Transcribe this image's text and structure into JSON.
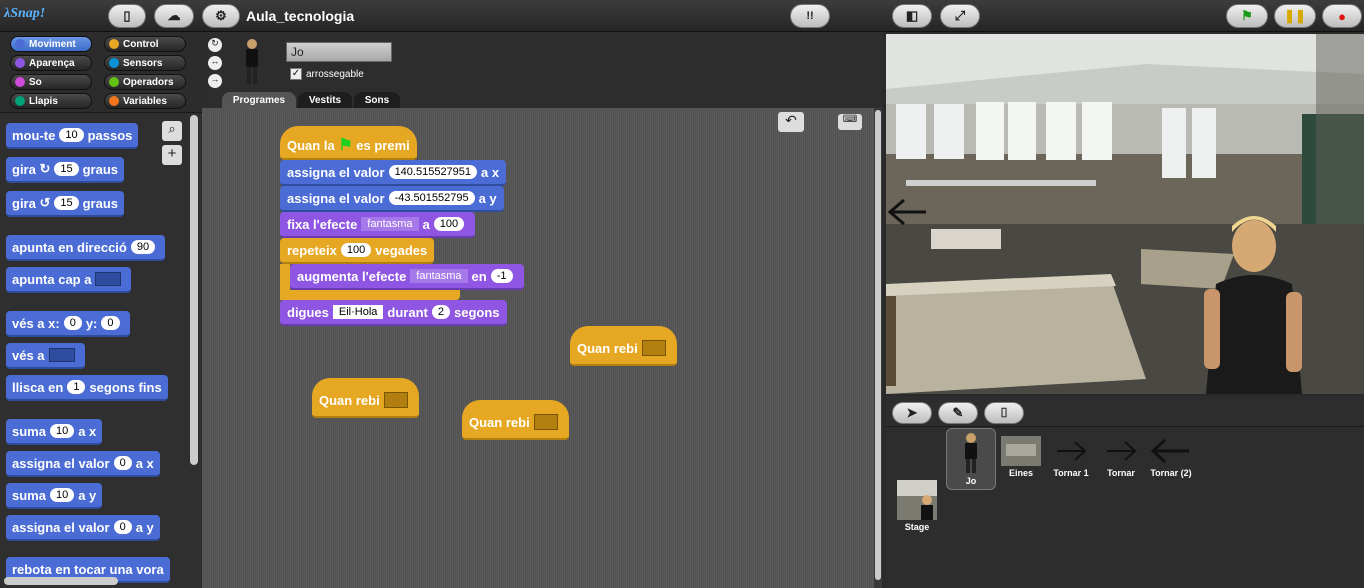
{
  "app": {
    "logo": "λSnap!",
    "project_name": "Aula_tecnologia"
  },
  "categories": [
    {
      "label": "Moviment",
      "color": "#4a6cd4"
    },
    {
      "label": "Control",
      "color": "#e6a822"
    },
    {
      "label": "Aparença",
      "color": "#8f56e3"
    },
    {
      "label": "Sensors",
      "color": "#0a94d6"
    },
    {
      "label": "So",
      "color": "#cf4ad9"
    },
    {
      "label": "Operadors",
      "color": "#62c213"
    },
    {
      "label": "Llapis",
      "color": "#00a178"
    },
    {
      "label": "Variables",
      "color": "#f3761d"
    }
  ],
  "palette": {
    "move": {
      "a": "mou-te",
      "v": "10",
      "b": "passos"
    },
    "turn_cw": {
      "a": "gira",
      "v": "15",
      "b": "graus"
    },
    "turn_ccw": {
      "a": "gira",
      "v": "15",
      "b": "graus"
    },
    "point_dir": {
      "a": "apunta en direcció",
      "v": "90"
    },
    "point_to": {
      "a": "apunta cap a"
    },
    "goto_xy": {
      "a": "vés a x:",
      "v1": "0",
      "b": "y:",
      "v2": "0"
    },
    "goto": {
      "a": "vés a"
    },
    "glide": {
      "a": "llisca en",
      "v": "1",
      "b": "segons fins"
    },
    "change_x": {
      "a": "suma",
      "v": "10",
      "b": "a x"
    },
    "set_x": {
      "a": "assigna el valor",
      "v": "0",
      "b": "a x"
    },
    "change_y": {
      "a": "suma",
      "v": "10",
      "b": "a y"
    },
    "set_y": {
      "a": "assigna el valor",
      "v": "0",
      "b": "a y"
    },
    "bounce": {
      "a": "rebota en tocar una vora"
    }
  },
  "sprite": {
    "name": "Jo",
    "draggable_label": "arrossegable"
  },
  "tabs": [
    "Programes",
    "Vestits",
    "Sons"
  ],
  "script": {
    "hat": {
      "a": "Quan la",
      "b": "es premi"
    },
    "set_x": {
      "a": "assigna el valor",
      "v": "140.515527951",
      "b": "a x"
    },
    "set_y": {
      "a": "assigna el valor",
      "v": "-43.501552795",
      "b": "a y"
    },
    "set_effect": {
      "a": "fixa l'efecte",
      "d": "fantasma",
      "b": "a",
      "v": "100"
    },
    "repeat": {
      "a": "repeteix",
      "v": "100",
      "b": "vegades"
    },
    "change_effect": {
      "a": "augmenta l'efecte",
      "d": "fantasma",
      "b": "en",
      "v": "-1"
    },
    "say": {
      "a": "digues",
      "v": "Eil·Hola",
      "b": "durant",
      "v2": "2",
      "c": "segons"
    }
  },
  "receive_hats": [
    "Quan rebi",
    "Quan rebi",
    "Quan rebi"
  ],
  "corral": {
    "sprites": [
      "Jo",
      "Eines",
      "Tornar 1",
      "Tornar",
      "Tornar (2)"
    ],
    "stage": "Stage"
  }
}
